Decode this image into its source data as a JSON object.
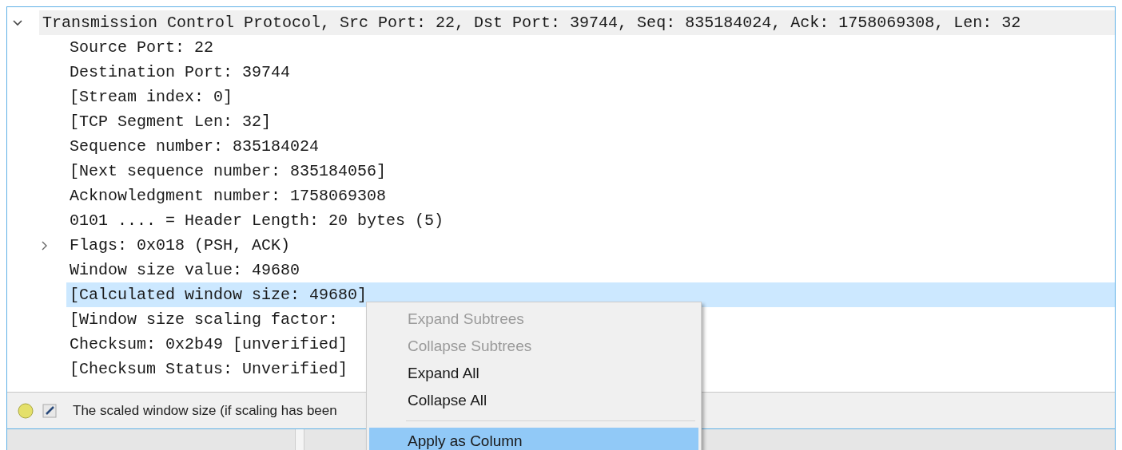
{
  "tree": [
    {
      "label": "Transmission Control Protocol, Src Port: 22, Dst Port: 39744, Seq: 835184024, Ack: 1758069308, Len: 32",
      "expanded": true,
      "selected": false,
      "children": [
        {
          "label": "Source Port: 22",
          "selected": false
        },
        {
          "label": "Destination Port: 39744",
          "selected": false
        },
        {
          "label": "[Stream index: 0]",
          "selected": false
        },
        {
          "label": "[TCP Segment Len: 32]",
          "selected": false
        },
        {
          "label": "Sequence number: 835184024",
          "selected": false
        },
        {
          "label": "[Next sequence number: 835184056]",
          "selected": false
        },
        {
          "label": "Acknowledgment number: 1758069308",
          "selected": false
        },
        {
          "label": "0101 .... = Header Length: 20 bytes (5)",
          "selected": false
        },
        {
          "label": "Flags: 0x018 (PSH, ACK)",
          "expanded": false,
          "selected": false
        },
        {
          "label": "Window size value: 49680",
          "selected": false
        },
        {
          "label": "[Calculated window size: 49680]",
          "selected": true
        },
        {
          "label": "[Window size scaling factor:",
          "selected": false
        },
        {
          "label": "Checksum: 0x2b49 [unverified]",
          "selected": false
        },
        {
          "label": "[Checksum Status: Unverified]",
          "selected": false
        }
      ]
    }
  ],
  "status_bar": {
    "text": "The scaled window size (if scaling has been"
  },
  "context_menu": [
    {
      "kind": "item",
      "label": "Expand Subtrees",
      "disabled": true,
      "selected": false
    },
    {
      "kind": "item",
      "label": "Collapse Subtrees",
      "disabled": true,
      "selected": false
    },
    {
      "kind": "item",
      "label": "Expand All",
      "disabled": false,
      "selected": false
    },
    {
      "kind": "item",
      "label": "Collapse All",
      "disabled": false,
      "selected": false
    },
    {
      "kind": "separator"
    },
    {
      "kind": "item",
      "label": "Apply as Column",
      "disabled": false,
      "selected": true
    }
  ]
}
